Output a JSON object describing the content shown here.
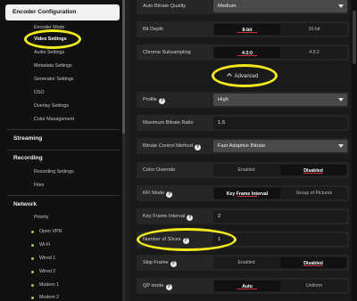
{
  "sidebar": {
    "active_section": "Encoder Configuration",
    "encoder_items": [
      "Encoder Mode",
      "Video Settings",
      "Audio Settings",
      "Metadata Settings",
      "Generator Settings",
      "DSO",
      "Overlay Settings",
      "Color Management"
    ],
    "active_item": "Video Settings",
    "streaming": "Streaming",
    "recording": "Recording",
    "recording_items": [
      "Recording Settings",
      "Files"
    ],
    "network": "Network",
    "network_items": [
      "Priority",
      "Open VPN",
      "Wi-Fi",
      "Wired 1",
      "Wired 2",
      "Modem 1",
      "Modem 2"
    ]
  },
  "settings": {
    "auto_bitrate_quality": {
      "label": "Auto Bitrate Quality",
      "value": "Medium"
    },
    "bit_depth": {
      "label": "Bit Depth",
      "options": [
        "8-bit",
        "10-bit"
      ],
      "selected": "8-bit"
    },
    "chroma_subsampling": {
      "label": "Chroma Subsampling",
      "options": [
        "4:2:0",
        "4:2:2"
      ],
      "selected": "4:2:0"
    },
    "advanced_label": "Advanced",
    "profile": {
      "label": "Profile",
      "value": "High"
    },
    "max_bitrate_ratio": {
      "label": "Maximum Bitrate Ratio",
      "value": "1.5"
    },
    "bitrate_control_method": {
      "label": "Bitrate Control Method",
      "value": "Fast Adaptive Bitrate"
    },
    "color_override": {
      "label": "Color Override",
      "options": [
        "Enabled",
        "Disabled"
      ],
      "selected": "Disabled"
    },
    "kfi_mode": {
      "label": "KFI Mode",
      "options": [
        "Key Frame Interval",
        "Group of Pictures"
      ],
      "selected": "Key Frame Interval"
    },
    "key_frame_interval": {
      "label": "Key Frame Interval",
      "value": "2"
    },
    "number_of_slices": {
      "label": "Number of Slices",
      "value": "1"
    },
    "skip_frame": {
      "label": "Skip Frame",
      "options": [
        "Enabled",
        "Disabled"
      ],
      "selected": "Disabled"
    },
    "qp_mode": {
      "label": "QP mode",
      "options": [
        "Auto",
        "Uniform"
      ],
      "selected": "Auto"
    }
  },
  "colors": {
    "accent": "#d2302b",
    "annotation": "#f2ea1d",
    "status_dot": "#9ecb57"
  }
}
